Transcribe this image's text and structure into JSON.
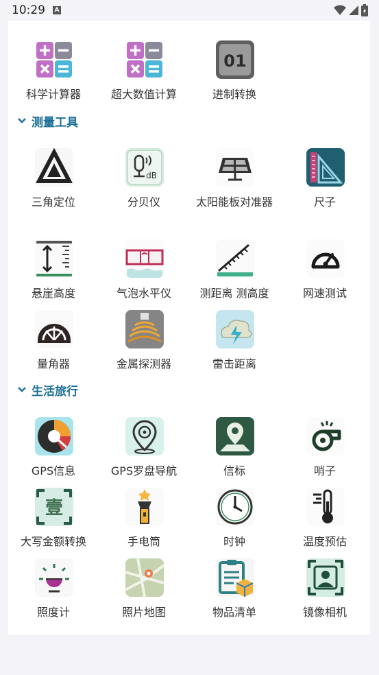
{
  "status": {
    "time": "10:29",
    "notif": "A"
  },
  "sections": [
    {
      "title": "",
      "items": [
        {
          "label": "科学计算器",
          "icon": "calculator-icon"
        },
        {
          "label": "超大数值计算",
          "icon": "big-calculator-icon"
        },
        {
          "label": "进制转换",
          "icon": "base-convert-icon"
        }
      ]
    },
    {
      "title": "测量工具",
      "items": [
        {
          "label": "三角定位",
          "icon": "triangle-locate-icon"
        },
        {
          "label": "分贝仪",
          "icon": "decibel-icon"
        },
        {
          "label": "太阳能板对准器",
          "icon": "solar-panel-icon"
        },
        {
          "label": "尺子",
          "icon": "ruler-icon"
        },
        {
          "label": "悬崖高度",
          "icon": "cliff-height-icon"
        },
        {
          "label": "气泡水平仪",
          "icon": "bubble-level-icon"
        },
        {
          "label": "测距离 测高度",
          "icon": "distance-height-icon"
        },
        {
          "label": "网速测试",
          "icon": "speedometer-icon"
        },
        {
          "label": "量角器",
          "icon": "protractor-icon"
        },
        {
          "label": "金属探测器",
          "icon": "metal-detector-icon"
        },
        {
          "label": "雷击距离",
          "icon": "lightning-icon"
        }
      ]
    },
    {
      "title": "生活旅行",
      "items": [
        {
          "label": "GPS信息",
          "icon": "gps-radar-icon"
        },
        {
          "label": "GPS罗盘导航",
          "icon": "compass-pin-icon"
        },
        {
          "label": "信标",
          "icon": "beacon-icon"
        },
        {
          "label": "哨子",
          "icon": "whistle-icon"
        },
        {
          "label": "大写金额转换",
          "icon": "chinese-amount-icon"
        },
        {
          "label": "手电筒",
          "icon": "flashlight-icon"
        },
        {
          "label": "时钟",
          "icon": "clock-icon"
        },
        {
          "label": "温度预估",
          "icon": "thermometer-icon"
        },
        {
          "label": "照度计",
          "icon": "light-meter-icon"
        },
        {
          "label": "照片地图",
          "icon": "photo-map-icon"
        },
        {
          "label": "物品清单",
          "icon": "checklist-icon"
        },
        {
          "label": "镜像相机",
          "icon": "mirror-camera-icon"
        }
      ]
    }
  ],
  "icon_text": {
    "db": "dB",
    "zh_one": "壹",
    "bin": "01"
  }
}
